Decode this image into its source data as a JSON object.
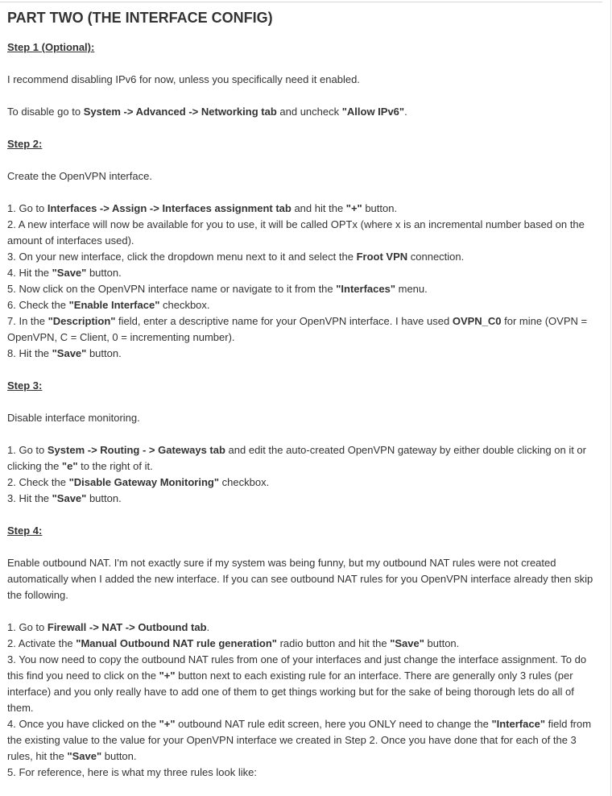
{
  "title": "PART TWO (THE INTERFACE CONFIG)",
  "steps": [
    {
      "heading": "Step 1 (Optional):",
      "paragraphs": [
        {
          "lines": [
            [
              {
                "t": "I recommend disabling IPv6 for now, unless you specifically need it enabled."
              }
            ]
          ]
        },
        {
          "lines": [
            [
              {
                "t": "To disable go to "
              },
              {
                "t": "System -> Advanced -> Networking tab",
                "b": true
              },
              {
                "t": " and uncheck "
              },
              {
                "t": "\"Allow IPv6\"",
                "b": true
              },
              {
                "t": "."
              }
            ]
          ]
        }
      ]
    },
    {
      "heading": "Step 2:",
      "paragraphs": [
        {
          "lines": [
            [
              {
                "t": "Create the OpenVPN interface."
              }
            ]
          ]
        },
        {
          "lines": [
            [
              {
                "t": "1. Go to "
              },
              {
                "t": "Interfaces -> Assign -> Interfaces assignment tab",
                "b": true
              },
              {
                "t": " and hit the "
              },
              {
                "t": "\"+\"",
                "b": true
              },
              {
                "t": " button."
              }
            ],
            [
              {
                "t": "2. A new interface will now be available for you to use, it will be called OPTx (where x is an incremental number based on the amount of interfaces used)."
              }
            ],
            [
              {
                "t": "3. On your new interface, click the dropdown menu next to it and select the "
              },
              {
                "t": "Froot VPN",
                "b": true
              },
              {
                "t": " connection."
              }
            ],
            [
              {
                "t": "4. Hit the "
              },
              {
                "t": "\"Save\"",
                "b": true
              },
              {
                "t": " button."
              }
            ],
            [
              {
                "t": "5. Now click on the OpenVPN interface name or navigate to it from the "
              },
              {
                "t": "\"Interfaces\"",
                "b": true
              },
              {
                "t": " menu."
              }
            ],
            [
              {
                "t": "6. Check the "
              },
              {
                "t": "\"Enable Interface\"",
                "b": true
              },
              {
                "t": " checkbox."
              }
            ],
            [
              {
                "t": "7. In the "
              },
              {
                "t": "\"Description\"",
                "b": true
              },
              {
                "t": " field, enter a descriptive name for your OpenVPN interface. I have used "
              },
              {
                "t": "OVPN_C0",
                "b": true
              },
              {
                "t": " for mine (OVPN = OpenVPN, C = Client, 0 = incrementing number)."
              }
            ],
            [
              {
                "t": "8. Hit the "
              },
              {
                "t": "\"Save\"",
                "b": true
              },
              {
                "t": " button."
              }
            ]
          ]
        }
      ]
    },
    {
      "heading": "Step 3:",
      "paragraphs": [
        {
          "lines": [
            [
              {
                "t": "Disable interface monitoring."
              }
            ]
          ]
        },
        {
          "lines": [
            [
              {
                "t": "1. Go to "
              },
              {
                "t": "System -> Routing - > Gateways tab",
                "b": true
              },
              {
                "t": " and edit the auto-created OpenVPN gateway by either double clicking on it or clicking the "
              },
              {
                "t": "\"e\"",
                "b": true
              },
              {
                "t": " to the right of it."
              }
            ],
            [
              {
                "t": "2. Check the "
              },
              {
                "t": "\"Disable Gateway Monitoring\"",
                "b": true
              },
              {
                "t": " checkbox."
              }
            ],
            [
              {
                "t": "3. Hit the "
              },
              {
                "t": "\"Save\"",
                "b": true
              },
              {
                "t": " button."
              }
            ]
          ]
        }
      ]
    },
    {
      "heading": "Step 4:",
      "paragraphs": [
        {
          "lines": [
            [
              {
                "t": "Enable outbound NAT. I'm not exactly sure if my system was being funny, but my outbound NAT rules were not created automatically when I added the new interface. If you can see outbound NAT rules for you OpenVPN interface already then skip the following."
              }
            ]
          ]
        },
        {
          "lines": [
            [
              {
                "t": "1. Go to "
              },
              {
                "t": "Firewall -> NAT -> Outbound tab",
                "b": true
              },
              {
                "t": "."
              }
            ],
            [
              {
                "t": "2. Activate the "
              },
              {
                "t": "\"Manual Outbound NAT rule generation\"",
                "b": true
              },
              {
                "t": " radio button and hit the "
              },
              {
                "t": "\"Save\"",
                "b": true
              },
              {
                "t": " button."
              }
            ],
            [
              {
                "t": "3. You now need to copy the outbound NAT rules from one of your interfaces and just change the interface assignment. To do this find you need to click on the "
              },
              {
                "t": "\"+\"",
                "b": true
              },
              {
                "t": " button next to each existing rule for an interface. There are generally only 3 rules (per interface) and you only really have to add one of them to get things working but for the sake of being thorough lets do all of them."
              }
            ],
            [
              {
                "t": "4. Once you have clicked on the "
              },
              {
                "t": "\"+\"",
                "b": true
              },
              {
                "t": " outbound NAT rule edit screen, here you ONLY need to change the "
              },
              {
                "t": "\"Interface\"",
                "b": true
              },
              {
                "t": " field from the existing value to the value for your OpenVPN interface we created in Step 2. Once you have done that for each of the 3 rules, hit the "
              },
              {
                "t": "\"Save\"",
                "b": true
              },
              {
                "t": " button."
              }
            ],
            [
              {
                "t": "5. For reference, here is what my three rules look like:"
              }
            ]
          ]
        }
      ]
    }
  ]
}
